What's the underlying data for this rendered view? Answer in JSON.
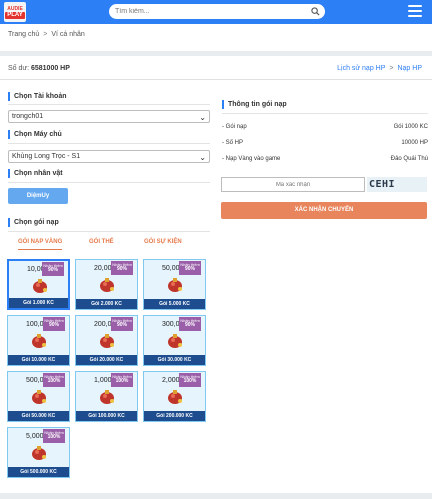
{
  "header": {
    "logo_top": "AUDIE",
    "logo_bottom": "PLAY",
    "search_placeholder": "Tìm kiếm...",
    "icons": {
      "search": "search-icon",
      "menu": "hamburger-menu-icon"
    }
  },
  "breadcrumb": {
    "home": "Trang chủ",
    "separator": ">",
    "current": "Ví cá nhân"
  },
  "balance": {
    "label": "Số dư:",
    "value": "6581000 HP"
  },
  "links": {
    "history": "Lịch sử nạp HP",
    "separator": ">",
    "topup": "Nạp HP"
  },
  "left": {
    "account_title": "Chọn Tài khoản",
    "account_value": "trongch01",
    "server_title": "Chọn Máy chủ",
    "server_value": "Khủng Long Trọc - S1",
    "character_title": "Chọn nhân vật",
    "character_button": "DiệmUy",
    "package_title": "Chọn gói nạp",
    "tabs": [
      "GÓI NẠP VÀNG",
      "GÓI THẺ",
      "GÓI SỰ KIỆN"
    ],
    "ribbon_text": "Nhận thêm",
    "packages": [
      {
        "amount": "10,000",
        "bonus": "90%",
        "label": "Gói 1.000 KC",
        "selected": true
      },
      {
        "amount": "20,000",
        "bonus": "90%",
        "label": "Gói 2.000 KC",
        "selected": false
      },
      {
        "amount": "50,000",
        "bonus": "90%",
        "label": "Gói 5.000 KC",
        "selected": false
      },
      {
        "amount": "100,000",
        "bonus": "90%",
        "label": "Gói 10.000 KC",
        "selected": false
      },
      {
        "amount": "200,000",
        "bonus": "90%",
        "label": "Gói 20.000 KC",
        "selected": false
      },
      {
        "amount": "300,000",
        "bonus": "90%",
        "label": "Gói 30.000 KC",
        "selected": false
      },
      {
        "amount": "500,000",
        "bonus": "100%",
        "label": "Gói 50.000 KC",
        "selected": false
      },
      {
        "amount": "1,000,000",
        "bonus": "100%",
        "label": "Gói 100.000 KC",
        "selected": false
      },
      {
        "amount": "2,000,000",
        "bonus": "100%",
        "label": "Gói 200.000 KC",
        "selected": false
      },
      {
        "amount": "5,000,000",
        "bonus": "100%",
        "label": "Gói 500.000 KC",
        "selected": false
      }
    ]
  },
  "right": {
    "info_title": "Thông tin gói nạp",
    "rows": [
      {
        "key": "- Gói nạp",
        "value": "Gói 1000 KC"
      },
      {
        "key": "- Số HP",
        "value": "10000 HP"
      },
      {
        "key": "- Nạp Vàng vào game",
        "value": "Đảo Quái Thú"
      }
    ],
    "captcha_placeholder": "Mã xác nhận",
    "captcha_code": "CEHI",
    "confirm_button": "XÁC NHẬN CHUYỂN"
  },
  "colors": {
    "primary": "#2d7ff5",
    "accent": "#e8855c",
    "card_label": "#1e4d8f",
    "ribbon": "#9a5fa8"
  }
}
